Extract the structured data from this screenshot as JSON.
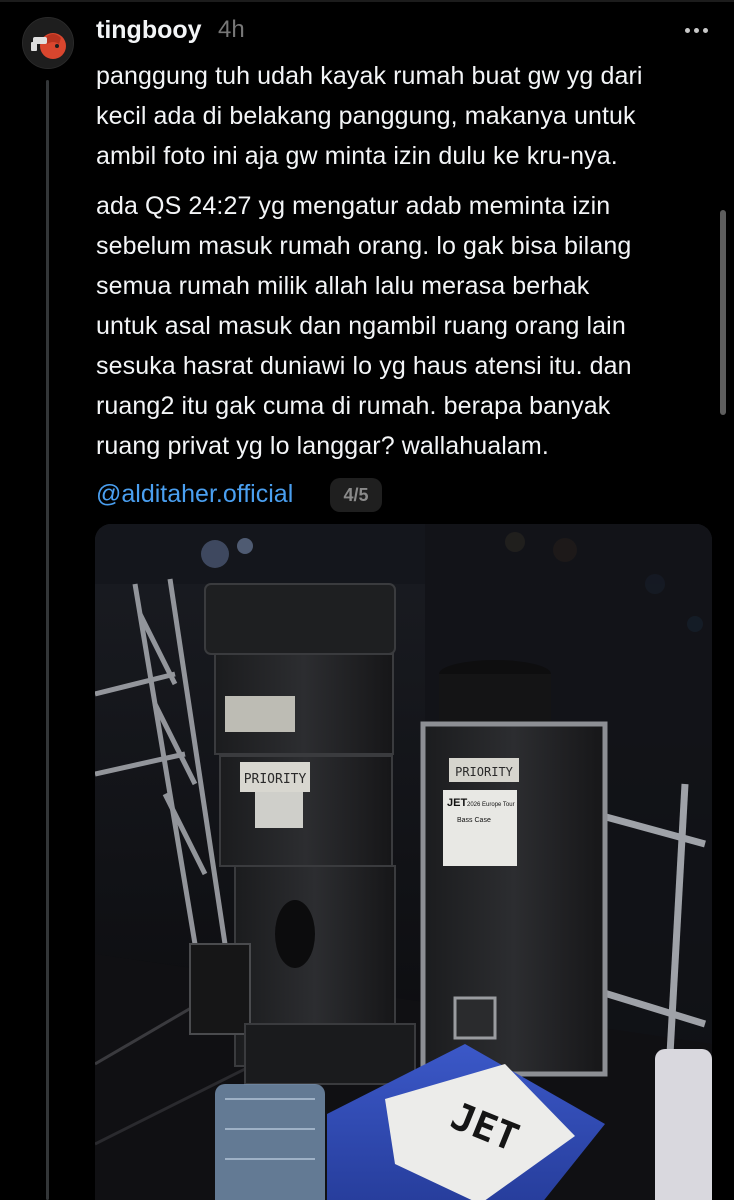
{
  "post": {
    "username": "tingbooy",
    "timestamp": "4h",
    "paragraph1": [
      "panggung tuh udah kayak rumah buat gw yg dari",
      "kecil ada di belakang panggung, makanya untuk",
      "ambil foto ini aja gw minta izin dulu ke kru-nya."
    ],
    "paragraph2": [
      "ada QS 24:27 yg mengatur adab meminta izin",
      "sebelum masuk rumah orang. lo gak bisa bilang",
      "semua rumah milik allah lalu merasa berhak",
      "untuk asal masuk dan ngambil ruang orang lain",
      "sesuka hasrat duniawi lo yg haus atensi itu. dan",
      "ruang2 itu gak cuma di rumah. berapa banyak",
      "ruang privat yg lo langgar? wallahualam."
    ],
    "mention": "@alditaher.official",
    "page_indicator": "4/5"
  },
  "photo": {
    "label_priority_left": "PRIORITY",
    "label_priority_right": "PRIORITY",
    "tag_brand": "JET",
    "tag_tour": "2026 Europe Tour",
    "tag_case": "Bass Case",
    "cooler_label": "JET"
  },
  "colors": {
    "background": "#000000",
    "text": "#f3f5f7",
    "muted": "#777777",
    "link": "#4a9ff0",
    "thread_line": "#333638"
  }
}
